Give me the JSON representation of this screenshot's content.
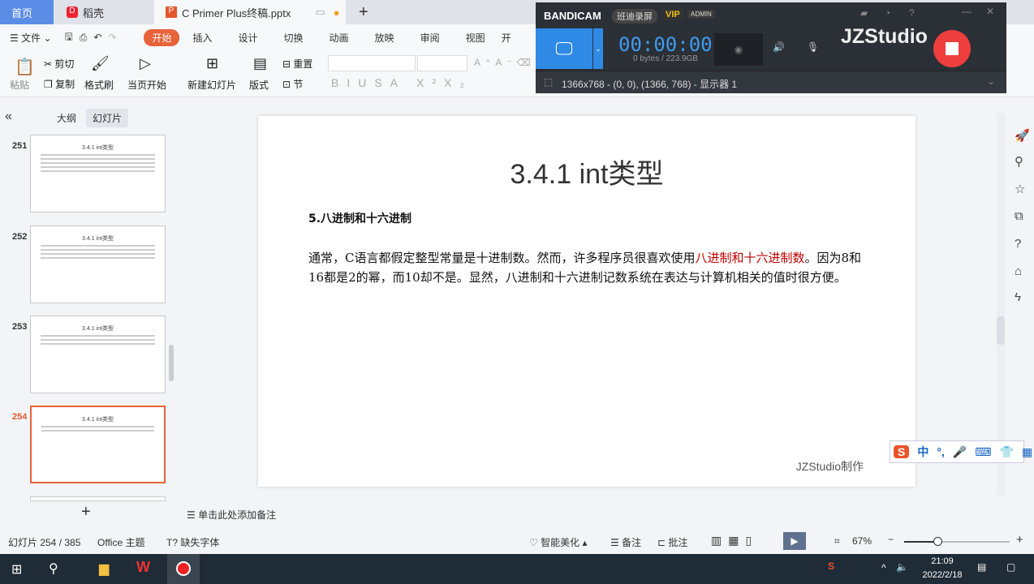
{
  "tabs": [
    {
      "label": "首页"
    },
    {
      "label": "稻壳"
    },
    {
      "label": "C Primer  Plus终稿.pptx"
    }
  ],
  "menu": {
    "file": "文件",
    "items": [
      "开始",
      "插入",
      "设计",
      "切换",
      "动画",
      "放映",
      "审阅",
      "视图",
      "开"
    ]
  },
  "ribbon": {
    "paste": "粘贴",
    "cut": "剪切",
    "copy": "复制",
    "format_painter": "格式刷",
    "play_from_current": "当页开始",
    "new_slide": "新建幻灯片",
    "layout": "版式",
    "reset": "重置",
    "section": "节"
  },
  "left_panel": {
    "tab_outline": "大纲",
    "tab_slides": "幻灯片",
    "thumbnails": [
      {
        "num": "251",
        "title": "3.4.1 int类型"
      },
      {
        "num": "252",
        "title": "3.4.1 int类型"
      },
      {
        "num": "253",
        "title": "3.4.1 int类型"
      },
      {
        "num": "254",
        "title": "3.4.1 int类型"
      }
    ],
    "add": "+"
  },
  "slide": {
    "title": "3.4.1 int类型",
    "heading": "5.八进制和十六进制",
    "para_a": "通常，C语言都假定整型常量是十进制数。然而，许多程序员很喜欢使用",
    "para_highlight": "八进制和十六进制数",
    "para_b": "。因为8和16都是2的幂，而10却不是。显然，八进制和十六进制记数系统在表达与计算机相关的值时很方便。",
    "footer": "JZStudio制作",
    "highlight_color": "#c00000"
  },
  "notes": "单击此处添加备注",
  "status": {
    "slide_count": "幻灯片 254 / 385",
    "theme": "Office 主题",
    "missing_font": "缺失字体",
    "beautify": "智能美化",
    "notes": "备注",
    "comment": "批注",
    "zoom": "67%"
  },
  "taskbar": {
    "time": "21:09",
    "date": "2022/2/18"
  },
  "bandicam": {
    "brand": "BANDICAM",
    "cn": "班迪录屏",
    "vip": "VIP",
    "admin": "ADMIN",
    "timer": "00:00:00",
    "size": "0 bytes / 223.9GB",
    "region": "1366x768 - (0, 0), (1366, 768) - 显示器 1",
    "watermark": "JZStudio"
  },
  "ime": {
    "lang": "中",
    "punct": "°,"
  }
}
